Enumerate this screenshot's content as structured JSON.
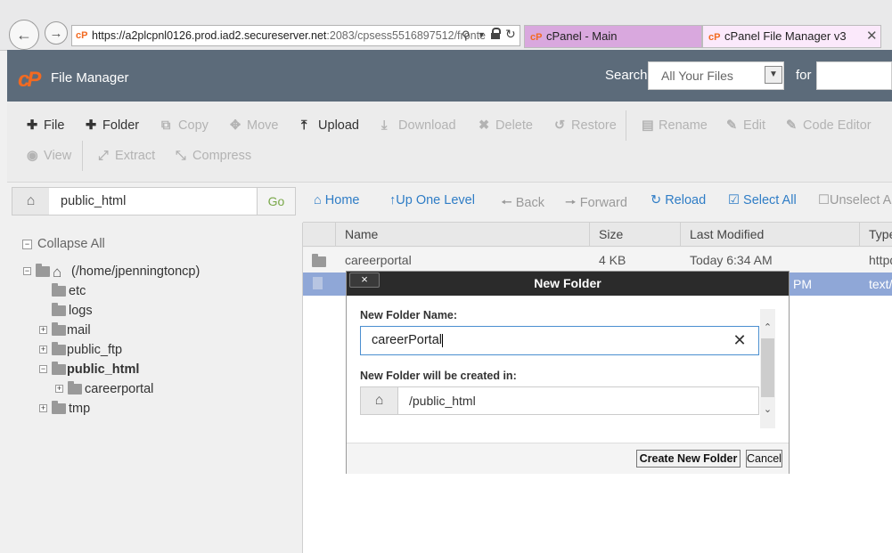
{
  "browser": {
    "url_prefix": "https://a2plcpnl0126.prod.iad2.",
    "url_domain": "secureserver.net",
    "url_rest": ":2083/cpsess5516897512/fronte",
    "tabs": [
      {
        "label": "cPanel - Main"
      },
      {
        "label": "cPanel File Manager v3"
      }
    ]
  },
  "header": {
    "logo": "cP",
    "app_title": "File Manager",
    "search_label": "Search",
    "search_scope": "All Your Files",
    "for_label": "for"
  },
  "toolbar": {
    "file": "File",
    "folder": "Folder",
    "copy": "Copy",
    "move": "Move",
    "upload": "Upload",
    "download": "Download",
    "delete": "Delete",
    "restore": "Restore",
    "rename": "Rename",
    "edit": "Edit",
    "code_editor": "Code Editor",
    "view": "View",
    "extract": "Extract",
    "compress": "Compress"
  },
  "path_bar": {
    "value": "public_html",
    "go": "Go"
  },
  "tree": {
    "collapse_all": "Collapse All",
    "root": "(/home/jpenningtoncp)",
    "items": [
      {
        "label": "etc"
      },
      {
        "label": "logs"
      },
      {
        "label": "mail"
      },
      {
        "label": "public_ftp"
      },
      {
        "label": "public_html"
      },
      {
        "label": "careerportal"
      },
      {
        "label": "tmp"
      }
    ]
  },
  "nav": {
    "home": "Home",
    "up_one_level": "Up One Level",
    "back": "Back",
    "forward": "Forward",
    "reload": "Reload",
    "select_all": "Select All",
    "unselect_all": "Unselect A"
  },
  "table": {
    "columns": [
      "Name",
      "Size",
      "Last Modified",
      "Type"
    ],
    "rows": [
      {
        "name": "careerportal",
        "size": "4 KB",
        "modified": "Today 6:34 AM",
        "type": "httpd"
      },
      {
        "name": "",
        "size": "",
        "modified": "PM",
        "type": "text/"
      }
    ]
  },
  "dialog": {
    "title": "New Folder",
    "close": "×",
    "name_label": "New Folder Name:",
    "name_value": "careerPortal",
    "location_label": "New Folder will be created in:",
    "location_value": "/public_html",
    "create_button": "Create New Folder",
    "cancel_button": "Cancel"
  },
  "colors": {
    "accent": "#2f7dc6",
    "header_bg": "#5c6b7a",
    "brand_orange": "#f26a21",
    "selected_row": "#8fa7d7"
  }
}
